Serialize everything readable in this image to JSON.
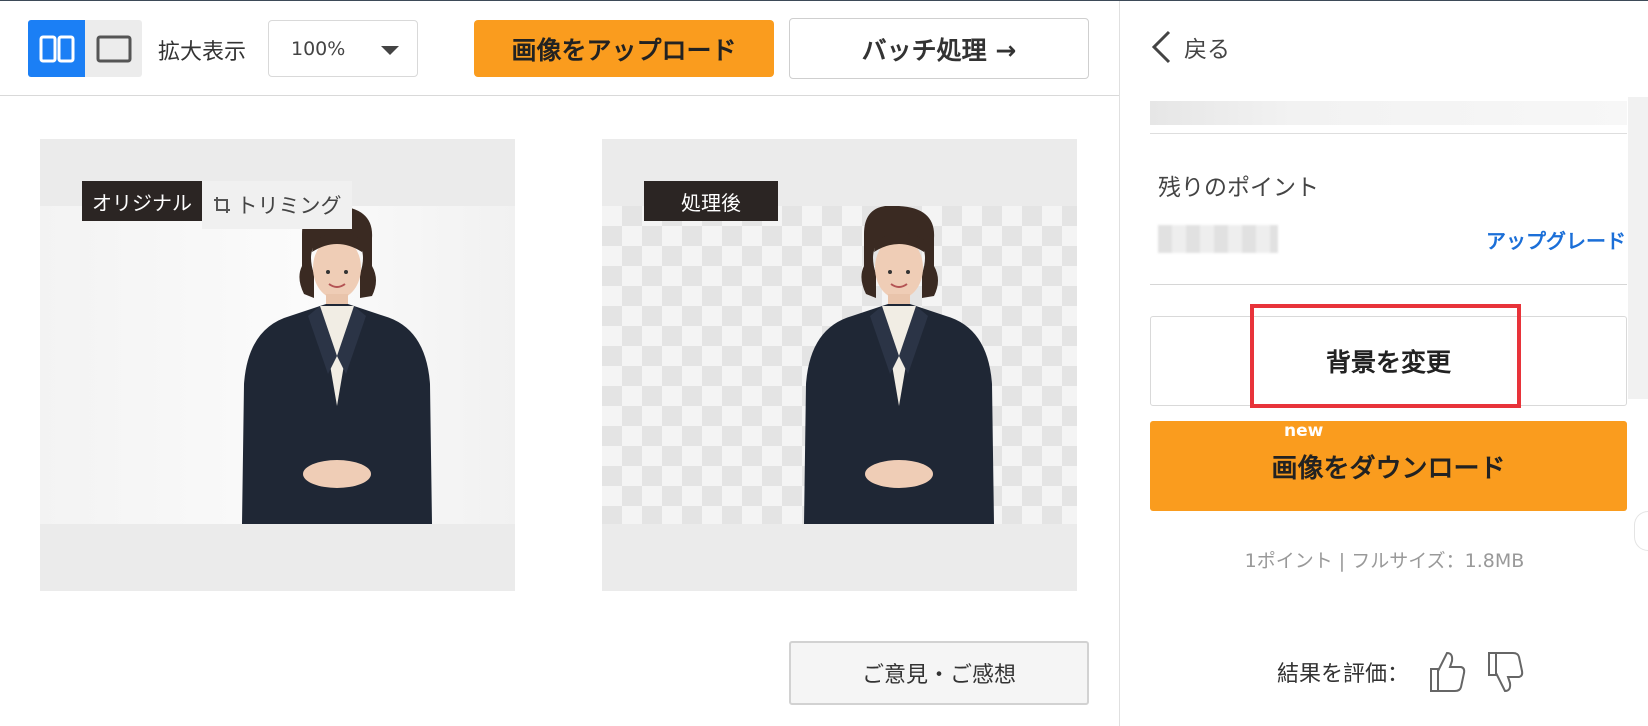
{
  "toolbar": {
    "zoom_label": "拡大表示",
    "zoom_value": "100%",
    "upload_label": "画像をアップロード",
    "batch_label": "バッチ処理 →"
  },
  "cards": {
    "original_tag": "オリジナル",
    "trim_label": "トリミング",
    "processed_tag": "処理後"
  },
  "feedback_label": "ご意見・ご感想",
  "panel": {
    "back_label": "戻る",
    "points_label": "残りのポイント",
    "upgrade_label": "アップグレード",
    "change_bg_label": "背景を変更",
    "new_badge": "new",
    "download_label": "画像をダウンロード",
    "size_info": "1ポイント | フルサイズ：1.8MB",
    "rate_label": "結果を評価："
  },
  "colors": {
    "accent_orange": "#fa9c1e",
    "accent_blue": "#1b7ff5",
    "link_blue": "#1b6fd8",
    "highlight_red": "#e8333a"
  },
  "icons": [
    "split-view-icon",
    "single-view-icon",
    "dropdown-caret-icon",
    "crop-icon",
    "back-chevron-icon",
    "thumbs-up-icon",
    "thumbs-down-icon"
  ]
}
